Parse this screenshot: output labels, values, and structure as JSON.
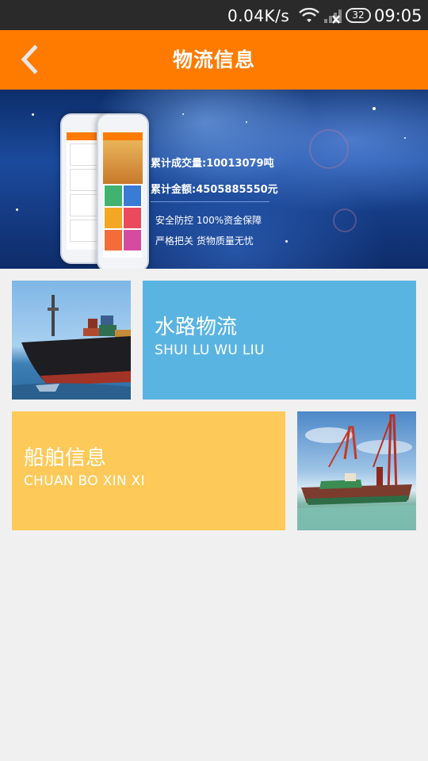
{
  "status_bar": {
    "network_speed": "0.04K/s",
    "battery_level": "32",
    "time": "09:05",
    "icons": [
      "wifi-icon",
      "signal-icon",
      "battery-icon"
    ]
  },
  "app_bar": {
    "title": "物流信息",
    "back_icon": "chevron-left-icon",
    "color": "#ff7b00"
  },
  "banner": {
    "line1_label": "累计成交量",
    "line1_value": "10013079吨",
    "line2_label": "累计金额",
    "line2_value": "4505885550元",
    "slogan1": "安全防控 100%资金保障",
    "slogan2": "严格把关 货物质量无忧"
  },
  "tiles": [
    {
      "title": "水路物流",
      "subtitle": "SHUI LU WU LIU",
      "color": "#5ab4e2",
      "image": "cargo-ship-image"
    },
    {
      "title": "船舶信息",
      "subtitle": "CHUAN BO XIN XI",
      "color": "#fdc958",
      "image": "harbor-cranes-image"
    }
  ]
}
